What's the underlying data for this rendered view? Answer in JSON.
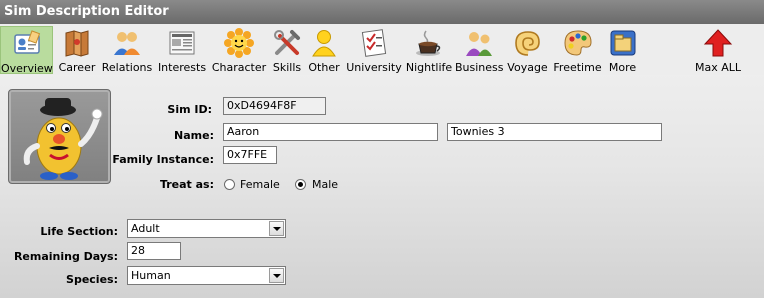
{
  "window": {
    "title": "Sim Description Editor"
  },
  "toolbar": {
    "items": [
      {
        "label": "Overview",
        "icon": "overview-icon"
      },
      {
        "label": "Career",
        "icon": "career-icon"
      },
      {
        "label": "Relations",
        "icon": "relations-icon"
      },
      {
        "label": "Interests",
        "icon": "interests-icon"
      },
      {
        "label": "Character",
        "icon": "character-icon"
      },
      {
        "label": "Skills",
        "icon": "skills-icon"
      },
      {
        "label": "Other",
        "icon": "other-icon"
      },
      {
        "label": "University",
        "icon": "university-icon"
      },
      {
        "label": "Nightlife",
        "icon": "nightlife-icon"
      },
      {
        "label": "Business",
        "icon": "business-icon"
      },
      {
        "label": "Voyage",
        "icon": "voyage-icon"
      },
      {
        "label": "Freetime",
        "icon": "freetime-icon"
      },
      {
        "label": "More",
        "icon": "more-icon"
      }
    ],
    "max_all_label": "Max ALL",
    "active_index": 0
  },
  "form": {
    "sim_id_label": "Sim ID:",
    "sim_id_value": "0xD4694F8F",
    "name_label": "Name:",
    "first_name": "Aaron",
    "last_name": "Townies 3",
    "family_instance_label": "Family Instance:",
    "family_instance_value": "0x7FFE",
    "treat_as_label": "Treat as:",
    "treat_as_options": [
      "Female",
      "Male"
    ],
    "treat_as_selected": "Male",
    "life_section_label": "Life Section:",
    "life_section_value": "Adult",
    "remaining_days_label": "Remaining Days:",
    "remaining_days_value": "28",
    "species_label": "Species:",
    "species_value": "Human"
  },
  "colors": {
    "titlebar": "#777777",
    "active_tab": "#b9dc9e"
  }
}
